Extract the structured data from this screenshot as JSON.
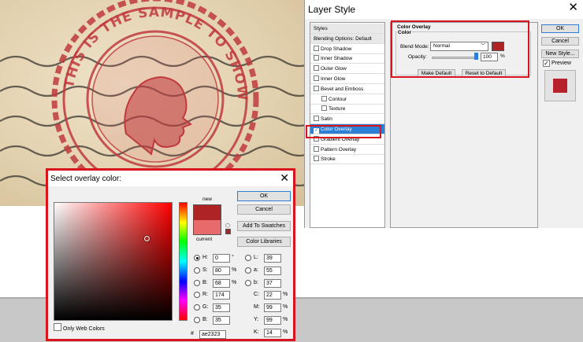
{
  "canvas": {
    "stamp_ring_text": "THIS IS THE SAMPLE TO SHOW STAMP EFFECT",
    "colors": {
      "paper": "#e3d2b0",
      "ink": "#c0393d"
    }
  },
  "layer_style": {
    "title": "Layer Style",
    "styles_list": [
      {
        "label": "Styles",
        "header": true
      },
      {
        "label": "Blending Options: Default",
        "header": true
      },
      {
        "label": "Drop Shadow",
        "checked": false
      },
      {
        "label": "Inner Shadow",
        "checked": false
      },
      {
        "label": "Outer Glow",
        "checked": false
      },
      {
        "label": "Inner Glow",
        "checked": false
      },
      {
        "label": "Bevel and Emboss",
        "checked": false
      },
      {
        "label": "Contour",
        "checked": false,
        "sub": true
      },
      {
        "label": "Texture",
        "checked": false,
        "sub": true
      },
      {
        "label": "Satin",
        "checked": false
      },
      {
        "label": "Color Overlay",
        "checked": true,
        "selected": true
      },
      {
        "label": "Gradient Overlay",
        "checked": false
      },
      {
        "label": "Pattern Overlay",
        "checked": false
      },
      {
        "label": "Stroke",
        "checked": false
      }
    ],
    "color_overlay": {
      "group_title": "Color Overlay",
      "color_label": "Color",
      "blend_mode_label": "Blend Mode:",
      "blend_mode_value": "Normal",
      "opacity_label": "Opacity:",
      "opacity_value": "100",
      "opacity_unit": "%",
      "opacity_level": 1.0,
      "swatch_color": "#ae2323",
      "make_default": "Make Default",
      "reset_to_default": "Reset to Default"
    },
    "buttons": {
      "ok": "OK",
      "cancel": "Cancel",
      "new_style": "New Style..."
    },
    "preview_label": "Preview",
    "preview_checked": true,
    "preview_color": "#b7222a",
    "highlight_color": "#d8141c"
  },
  "picker": {
    "title": "Select overlay color:",
    "new_label": "new",
    "current_label": "current",
    "new_color": "#ae2323",
    "current_color": "#e86a6a",
    "buttons": {
      "ok": "OK",
      "cancel": "Cancel",
      "add_to_swatches": "Add To Swatches",
      "color_libraries": "Color Libraries"
    },
    "only_web_colors": "Only Web Colors",
    "hsb": [
      {
        "key": "H",
        "label": "H:",
        "value": "0",
        "unit": "°",
        "selected": true
      },
      {
        "key": "S",
        "label": "S:",
        "value": "80",
        "unit": "%"
      },
      {
        "key": "B",
        "label": "B:",
        "value": "68",
        "unit": "%"
      }
    ],
    "rgb": [
      {
        "key": "R",
        "label": "R:",
        "value": "174"
      },
      {
        "key": "G",
        "label": "G:",
        "value": "35"
      },
      {
        "key": "B",
        "label": "B:",
        "value": "35"
      }
    ],
    "lab": [
      {
        "key": "L",
        "label": "L:",
        "value": "39"
      },
      {
        "key": "a",
        "label": "a:",
        "value": "55"
      },
      {
        "key": "b",
        "label": "b:",
        "value": "37"
      }
    ],
    "cmyk": [
      {
        "key": "C",
        "label": "C:",
        "value": "22",
        "unit": "%"
      },
      {
        "key": "M",
        "label": "M:",
        "value": "99",
        "unit": "%"
      },
      {
        "key": "Y",
        "label": "Y:",
        "value": "99",
        "unit": "%"
      },
      {
        "key": "K",
        "label": "K:",
        "value": "14",
        "unit": "%"
      }
    ],
    "hex_label": "#",
    "hex_value": "ae2323"
  }
}
